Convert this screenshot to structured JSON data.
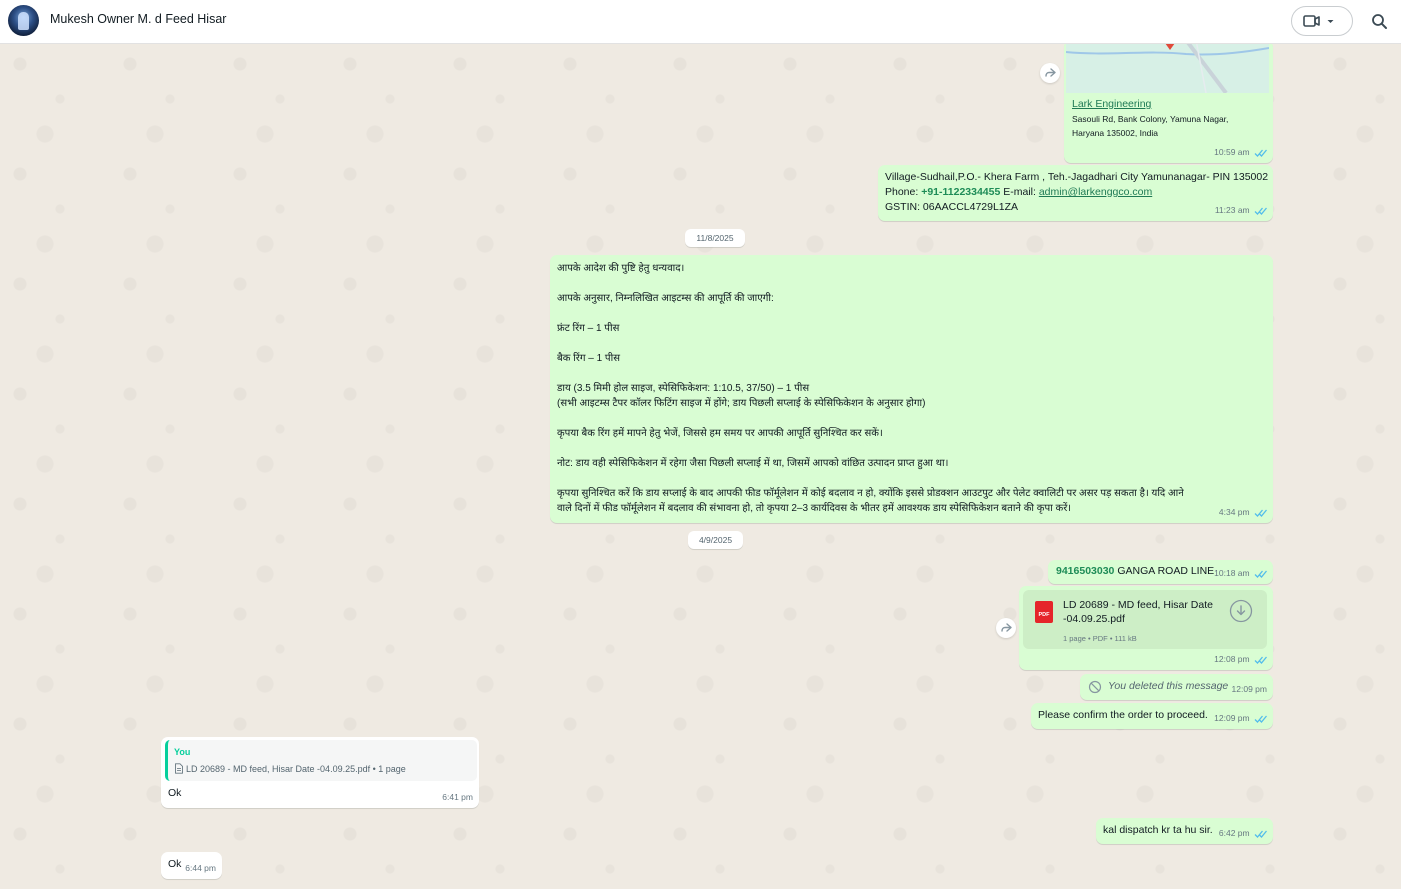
{
  "header": {
    "contact_name": "Mukesh Owner M. d Feed Hisar",
    "video_icon": "video-call-icon",
    "search_icon": "search-icon"
  },
  "colors": {
    "outgoing_bubble": "#d9fdd3",
    "incoming_bubble": "#ffffff",
    "chat_background": "#efeae2",
    "read_ticks": "#53bdeb"
  },
  "messages": {
    "location": {
      "place_name": "Lark Engineering",
      "address_line1": "Sasouli Rd, Bank Colony, Yamuna Nagar,",
      "address_line2": "Haryana 135002, India",
      "time": "10:59 am"
    },
    "address": {
      "line1": "Village-Sudhail,P.O.- Khera Farm , Teh.-Jagadhari City Yamunanagar- PIN 135002",
      "phone_label": "Phone: ",
      "phone": "+91-1122334455",
      "email_label": " E-mail: ",
      "email": "admin@larkenggco.com",
      "line3": "GSTIN: 06AACCL4729L1ZA",
      "time": "11:23 am"
    },
    "date1": "11/8/2025",
    "order": {
      "p1": "आपके आदेश की पुष्टि हेतु धन्यवाद।",
      "p2": "आपके अनुसार, निम्नलिखित आइटम्स की आपूर्ति की जाएगी:",
      "p3": "फ्रंट रिंग – 1 पीस",
      "p4": "बैक रिंग – 1 पीस",
      "p5a": "डाय (3.5 मिमी होल साइज, स्पेसिफिकेशन: 1:10.5, 37/50) – 1 पीस",
      "p5b": "(सभी आइटम्स टैपर कॉलर फिटिंग साइज में होंगे; डाय पिछली सप्लाई के स्पेसिफिकेशन के अनुसार होगा)",
      "p6": "कृपया  बैक रिंग हमें मापने हेतु भेजें, जिससे हम समय पर आपकी आपूर्ति सुनिश्चित कर सकें।",
      "p7": "नोट: डाय वही स्पेसिफिकेशन में रहेगा जैसा पिछली सप्लाई में था, जिसमें आपको वांछित उत्पादन प्राप्त हुआ था।",
      "p8a": "कृपया सुनिश्चित करें कि डाय सप्लाई के बाद आपकी फीड फॉर्मूलेशन में कोई बदलाव न हो, क्योंकि इससे प्रोडक्शन आउटपुट और पेलेट क्वालिटी पर असर पड़ सकता है। यदि आने",
      "p8b": "वाले दिनों में फीड फॉर्मूलेशन में बदलाव की संभावना हो, तो कृपया 2–3 कार्यदिवस के भीतर हमें आवश्यक डाय स्पेसिफिकेशन बताने की कृपा करें।",
      "time": "4:34 pm"
    },
    "date2": "4/9/2025",
    "ganga": {
      "number": "9416503030",
      "text": " GANGA ROAD LINE",
      "time": "10:18 am"
    },
    "pdf": {
      "icon_label": "PDF",
      "filename_line1": "LD 20689 - MD feed, Hisar Date",
      "filename_line2": "-04.09.25.pdf",
      "details": "1 page • PDF • 111 kB",
      "time": "12:08 pm"
    },
    "deleted": {
      "text": "You deleted this message",
      "time": "12:09 pm"
    },
    "confirm": {
      "text": "Please confirm the order to proceed.",
      "time": "12:09 pm"
    },
    "reply_ok": {
      "quoted_author": "You",
      "quoted_text": "LD 20689  - MD feed, Hisar Date -04.09.25.pdf • 1 page",
      "text": "Ok",
      "time": "6:41 pm"
    },
    "dispatch": {
      "text": "kal dispatch kr ta hu sir.",
      "time": "6:42 pm"
    },
    "ok2": {
      "text": "Ok",
      "time": "6:44 pm"
    }
  }
}
